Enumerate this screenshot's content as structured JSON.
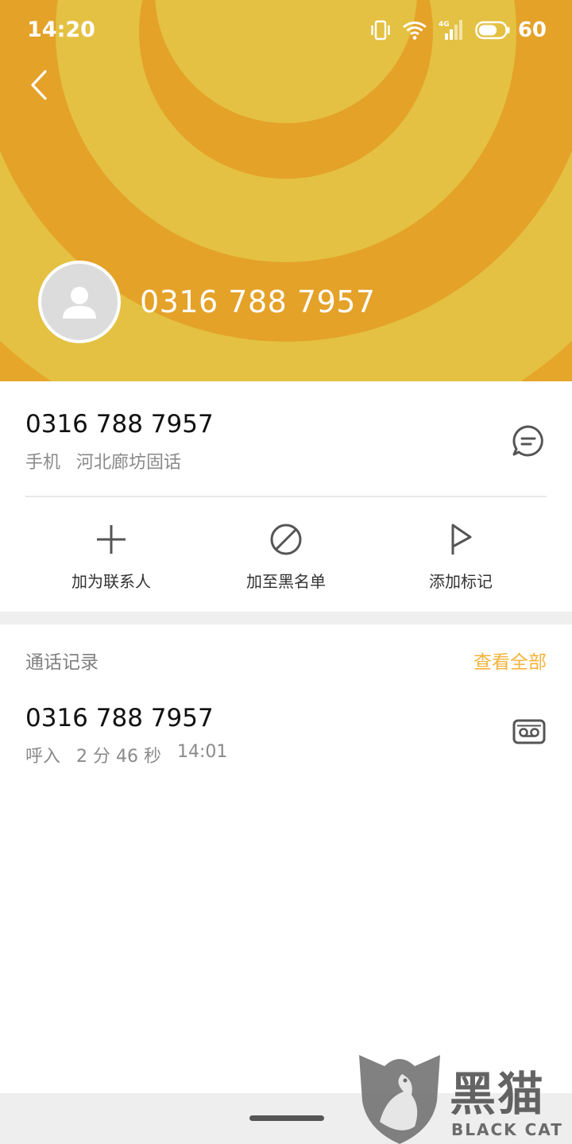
{
  "status_bar": {
    "time": "14:20",
    "icons": [
      "vibrate-icon",
      "wifi-icon",
      "signal-4g-icon",
      "battery-icon"
    ],
    "network": "4G",
    "battery": "60"
  },
  "header": {
    "phone_number": "0316 788 7957",
    "colors": {
      "ring_light": "#e4c142",
      "ring_dark": "#e4a229"
    }
  },
  "number_card": {
    "number": "0316 788 7957",
    "type": "手机",
    "location": "河北廊坊固话"
  },
  "actions": [
    {
      "label": "加为联系人",
      "icon": "plus-icon"
    },
    {
      "label": "加至黑名单",
      "icon": "block-icon"
    },
    {
      "label": "添加标记",
      "icon": "flag-icon"
    }
  ],
  "call_log": {
    "title": "通话记录",
    "view_all": "查看全部",
    "items": [
      {
        "number": "0316 788 7957",
        "direction": "呼入",
        "duration": "2 分 46 秒",
        "time": "14:01"
      }
    ]
  },
  "watermark": {
    "cn": "黑猫",
    "en": "BLACK CAT"
  },
  "accent_color": "#f4b33b"
}
